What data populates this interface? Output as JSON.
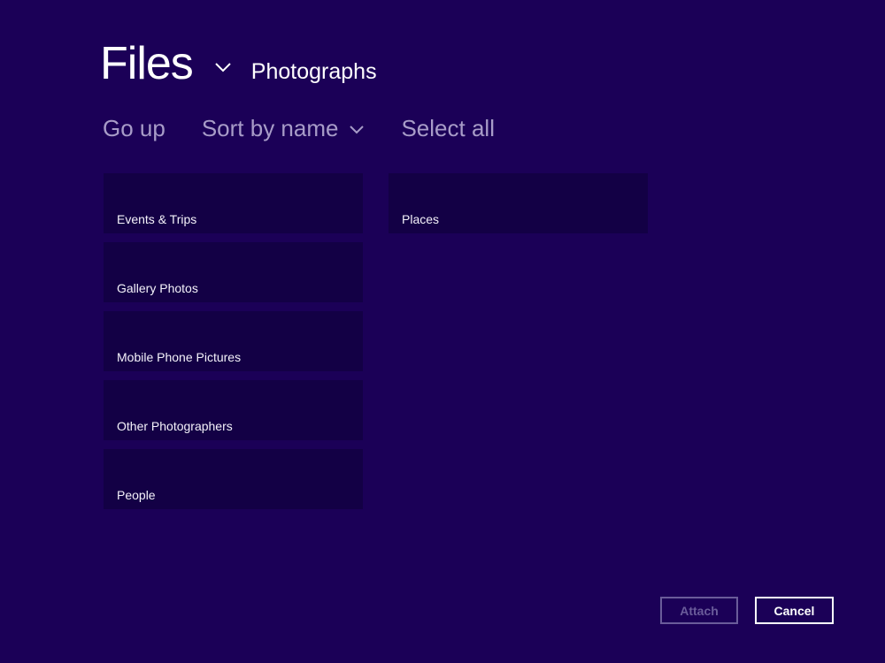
{
  "header": {
    "title": "Files",
    "title_dropdown_icon": "chevron-down-icon",
    "location": "Photographs"
  },
  "toolbar": {
    "go_up": "Go up",
    "sort": "Sort by name",
    "sort_icon": "chevron-down-icon",
    "select_all": "Select all"
  },
  "folders": [
    {
      "label": "Events  & Trips"
    },
    {
      "label": "Gallery Photos"
    },
    {
      "label": "Mobile Phone Pictures"
    },
    {
      "label": "Other Photographers"
    },
    {
      "label": "People"
    },
    {
      "label": "Places"
    }
  ],
  "footer": {
    "attach": "Attach",
    "attach_enabled": false,
    "cancel": "Cancel"
  },
  "colors": {
    "background": "#1b0057",
    "tile": "#130045",
    "toolbar_text": "#a89cc8",
    "disabled": "#6a5c9a"
  }
}
